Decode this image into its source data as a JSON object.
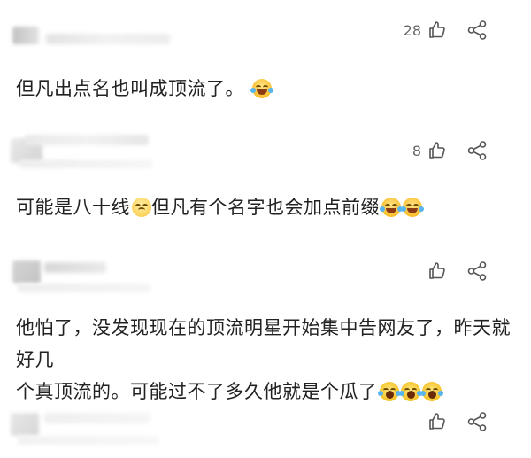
{
  "comments": [
    {
      "id": "comment-1",
      "text": "但凡出点名也叫成顶流了。",
      "emojis": [
        "laughing-crying-emoji"
      ],
      "like_count": "28"
    },
    {
      "id": "comment-2",
      "text_part1": "可能是八十线",
      "text_part2": "但凡有个名字也会加点前缀",
      "emojis": [
        "sad-face-emoji",
        "laughing-crying-emoji",
        "laughing-crying-emoji"
      ],
      "like_count": "8"
    },
    {
      "id": "comment-3",
      "text_line1": "他怕了，没发现现在的顶流明星开始集中告网友了，昨天就好几",
      "text_line2": "个真顶流的。可能过不了多久他就是个瓜了",
      "emojis": [
        "crying-laughing-emoji",
        "crying-laughing-emoji",
        "crying-laughing-emoji"
      ],
      "like_count": ""
    },
    {
      "id": "comment-4",
      "like_count": ""
    }
  ],
  "icons": {
    "like": "thumbs-up-icon",
    "share": "share-icon"
  }
}
